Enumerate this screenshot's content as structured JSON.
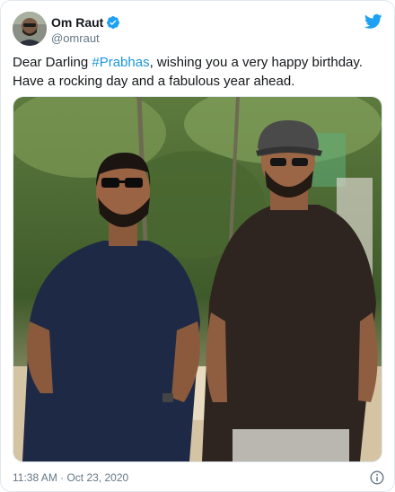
{
  "author": {
    "display_name": "Om Raut",
    "handle": "@omraut",
    "verified": true
  },
  "tweet": {
    "text_before": "Dear Darling ",
    "hashtag": "#Prabhas",
    "text_after": ", wishing you a very happy birthday. Have a rocking day and a fabulous year ahead."
  },
  "footer": {
    "timestamp": "11:38 AM · Oct 23, 2020"
  },
  "icons": {
    "brand": "twitter-bird-icon",
    "verified": "verified-badge-icon",
    "info": "info-icon"
  },
  "colors": {
    "brand_blue": "#1da1f2",
    "hashtag_blue": "#1b95e0",
    "muted_text": "#657786"
  }
}
